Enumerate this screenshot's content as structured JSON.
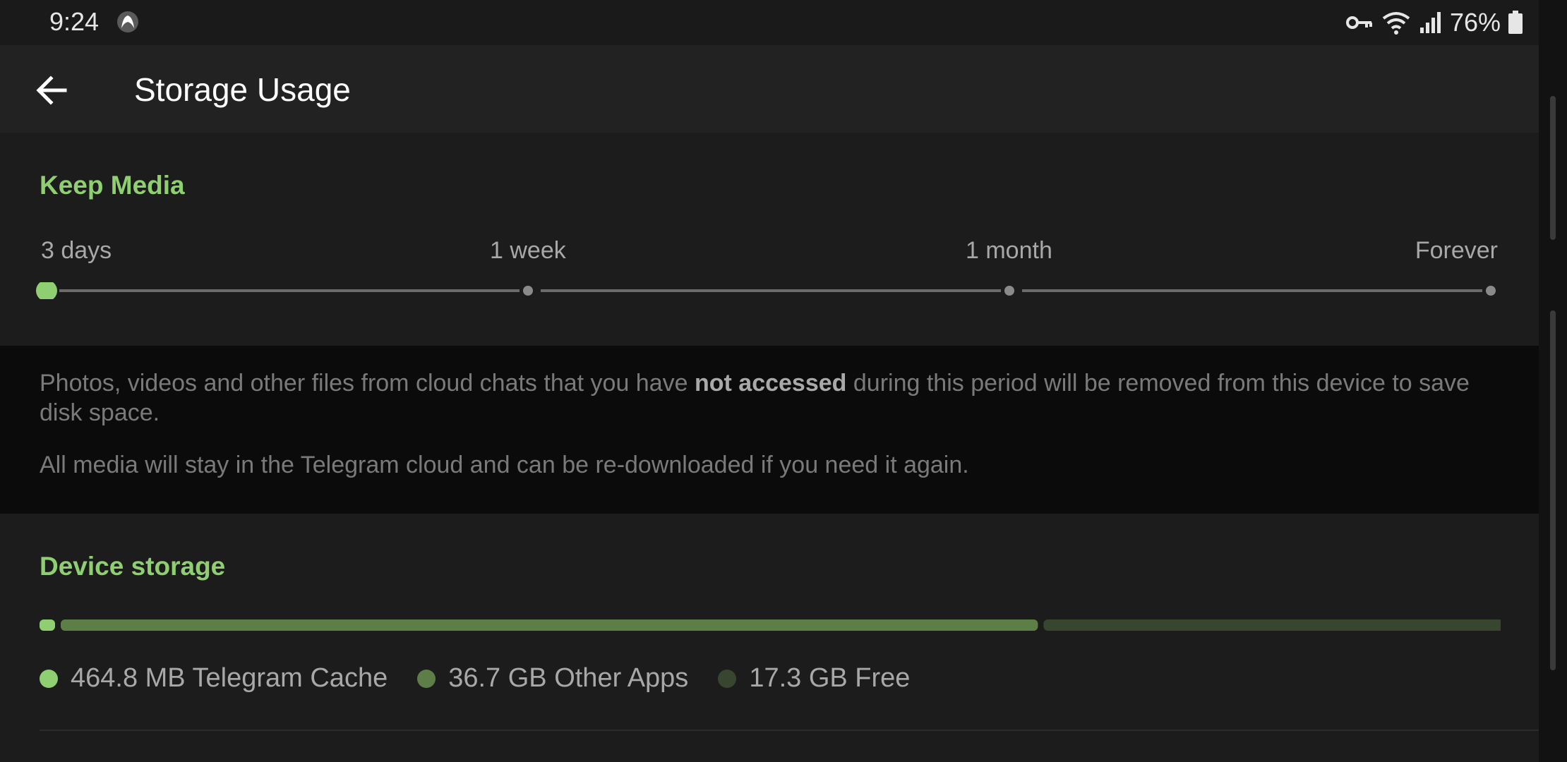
{
  "status_bar": {
    "time": "9:24",
    "battery": "76%",
    "icons": [
      "app-notification-icon",
      "vpn-key-icon",
      "wifi-icon",
      "signal-icon",
      "battery-icon"
    ]
  },
  "header": {
    "title": "Storage Usage",
    "back_icon": "back-arrow-icon"
  },
  "keep_media": {
    "title": "Keep Media",
    "options": [
      "3 days",
      "1 week",
      "1 month",
      "Forever"
    ],
    "selected_index": 0,
    "selected": "3 days"
  },
  "info": {
    "p1_before": "Photos, videos and other files from cloud chats that you have ",
    "p1_bold": "not accessed",
    "p1_after": " during this period will be removed from this device to save disk space.",
    "p2": "All media will stay in the Telegram cloud and can be re-downloaded if you need it again."
  },
  "device_storage": {
    "title": "Device storage",
    "legend": [
      {
        "label": "464.8 MB Telegram Cache",
        "color": "#8fcf72"
      },
      {
        "label": "36.7 GB Other Apps",
        "color": "#5d7f47"
      },
      {
        "label": "17.3 GB Free",
        "color": "#38452f"
      }
    ],
    "fractions": [
      0.0085,
      0.674,
      0.3175
    ]
  },
  "colors": {
    "accent": "#8fcf72",
    "background": "#1c1c1c",
    "header": "#222222"
  }
}
